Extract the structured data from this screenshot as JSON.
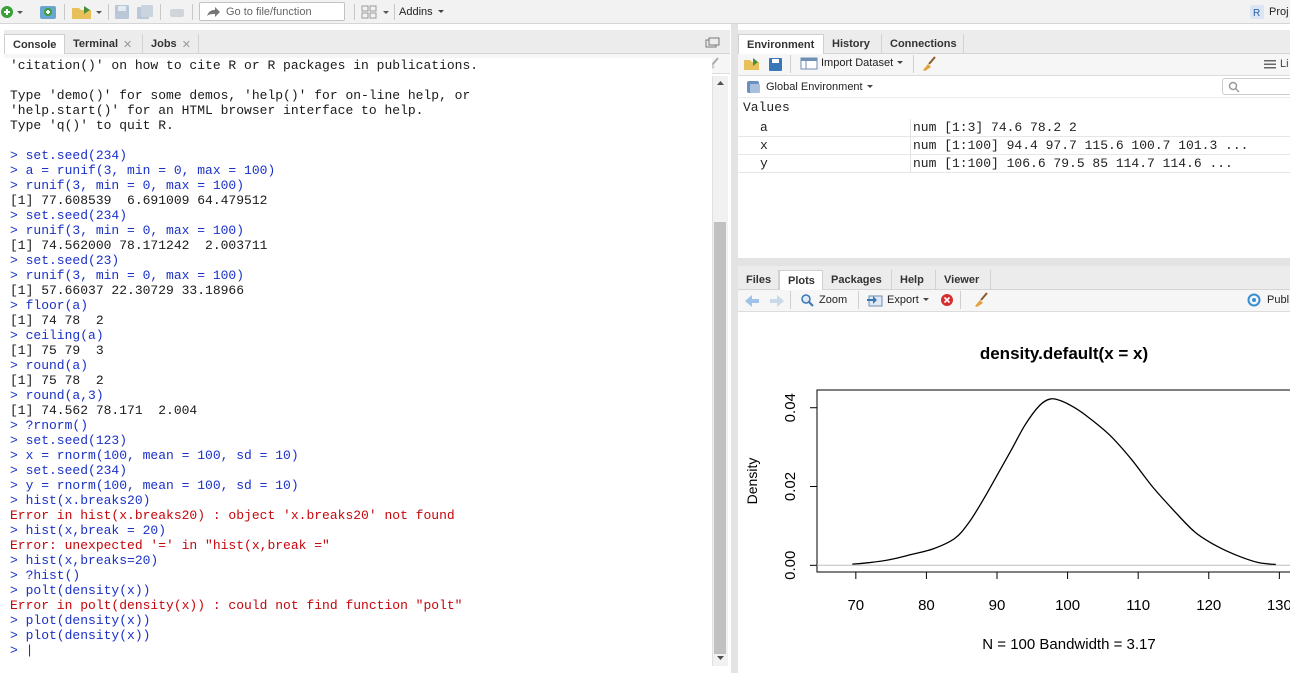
{
  "toolbar": {
    "goto_placeholder": "Go to file/function",
    "addins_label": "Addins",
    "project_label": "Proj"
  },
  "console_pane": {
    "tabs": [
      {
        "label": "Console",
        "active": true
      },
      {
        "label": "Terminal",
        "active": false
      },
      {
        "label": "Jobs",
        "active": false
      }
    ],
    "path": "~/",
    "lines": [
      {
        "kind": "out",
        "text": "'citation()' on how to cite R or R packages in publications."
      },
      {
        "kind": "blank",
        "text": ""
      },
      {
        "kind": "out",
        "text": "Type 'demo()' for some demos, 'help()' for on-line help, or"
      },
      {
        "kind": "out",
        "text": "'help.start()' for an HTML browser interface to help."
      },
      {
        "kind": "out",
        "text": "Type 'q()' to quit R."
      },
      {
        "kind": "blank",
        "text": ""
      },
      {
        "kind": "cmd",
        "text": "> set.seed(234)"
      },
      {
        "kind": "cmd",
        "text": "> a = runif(3, min = 0, max = 100)"
      },
      {
        "kind": "cmd",
        "text": "> runif(3, min = 0, max = 100)"
      },
      {
        "kind": "out",
        "text": "[1] 77.608539  6.691009 64.479512"
      },
      {
        "kind": "cmd",
        "text": "> set.seed(234)"
      },
      {
        "kind": "cmd",
        "text": "> runif(3, min = 0, max = 100)"
      },
      {
        "kind": "out",
        "text": "[1] 74.562000 78.171242  2.003711"
      },
      {
        "kind": "cmd",
        "text": "> set.seed(23)"
      },
      {
        "kind": "cmd",
        "text": "> runif(3, min = 0, max = 100)"
      },
      {
        "kind": "out",
        "text": "[1] 57.66037 22.30729 33.18966"
      },
      {
        "kind": "cmd",
        "text": "> floor(a)"
      },
      {
        "kind": "out",
        "text": "[1] 74 78  2"
      },
      {
        "kind": "cmd",
        "text": "> ceiling(a)"
      },
      {
        "kind": "out",
        "text": "[1] 75 79  3"
      },
      {
        "kind": "cmd",
        "text": "> round(a)"
      },
      {
        "kind": "out",
        "text": "[1] 75 78  2"
      },
      {
        "kind": "cmd",
        "text": "> round(a,3)"
      },
      {
        "kind": "out",
        "text": "[1] 74.562 78.171  2.004"
      },
      {
        "kind": "cmd",
        "text": "> ?rnorm()"
      },
      {
        "kind": "cmd",
        "text": "> set.seed(123)"
      },
      {
        "kind": "cmd",
        "text": "> x = rnorm(100, mean = 100, sd = 10)"
      },
      {
        "kind": "cmd",
        "text": "> set.seed(234)"
      },
      {
        "kind": "cmd",
        "text": "> y = rnorm(100, mean = 100, sd = 10)"
      },
      {
        "kind": "cmd",
        "text": "> hist(x.breaks20)"
      },
      {
        "kind": "err",
        "text": "Error in hist(x.breaks20) : object 'x.breaks20' not found"
      },
      {
        "kind": "cmd",
        "text": "> hist(x,break = 20)"
      },
      {
        "kind": "err",
        "text": "Error: unexpected '=' in \"hist(x,break =\""
      },
      {
        "kind": "cmd",
        "text": "> hist(x,breaks=20)"
      },
      {
        "kind": "cmd",
        "text": "> ?hist()"
      },
      {
        "kind": "cmd",
        "text": "> polt(density(x))"
      },
      {
        "kind": "err",
        "text": "Error in polt(density(x)) : could not find function \"polt\""
      },
      {
        "kind": "cmd",
        "text": "> plot(density(x))"
      },
      {
        "kind": "cmd",
        "text": "> plot(density(x))"
      },
      {
        "kind": "cmd",
        "text": "> |"
      }
    ]
  },
  "env_pane": {
    "tabs": [
      {
        "label": "Environment",
        "active": true
      },
      {
        "label": "History",
        "active": false
      },
      {
        "label": "Connections",
        "active": false
      }
    ],
    "import_label": "Import Dataset",
    "scope_label": "Global Environment",
    "list_label": "Li",
    "section_label": "Values",
    "rows": [
      {
        "name": "a",
        "value": "num [1:3] 74.6 78.2 2"
      },
      {
        "name": "x",
        "value": "num [1:100] 94.4 97.7 115.6 100.7 101.3 ..."
      },
      {
        "name": "y",
        "value": "num [1:100] 106.6 79.5 85 114.7 114.6 ..."
      }
    ]
  },
  "files_pane": {
    "tabs": [
      {
        "label": "Files",
        "active": false
      },
      {
        "label": "Plots",
        "active": true
      },
      {
        "label": "Packages",
        "active": false
      },
      {
        "label": "Help",
        "active": false
      },
      {
        "label": "Viewer",
        "active": false
      }
    ],
    "zoom_label": "Zoom",
    "export_label": "Export",
    "publish_label": "Publ"
  },
  "colors": {
    "command": "#1a31c8",
    "error": "#c5060b",
    "scrollbar_thumb": "#c1c1c1"
  },
  "chart_data": {
    "type": "line",
    "title": "density.default(x = x)",
    "xlabel": "N = 100   Bandwidth = 3.17",
    "ylabel": "Density",
    "x_ticks": [
      70,
      80,
      90,
      100,
      110,
      120,
      130
    ],
    "y_ticks": [
      "0.00",
      "0.02",
      "0.04"
    ],
    "xlim": [
      64.5,
      132.5
    ],
    "ylim": [
      -0.0017,
      0.0445
    ],
    "grid": false,
    "series": [
      {
        "x": [
          69.5,
          72,
          75,
          78,
          81,
          84,
          86,
          88,
          90,
          92,
          94,
          96,
          97.5,
          99,
          101,
          103,
          106,
          109,
          112,
          115,
          118,
          121,
          124,
          127,
          129.5
        ],
        "y": [
          0.0003,
          0.0007,
          0.0015,
          0.0028,
          0.0042,
          0.0068,
          0.0108,
          0.0165,
          0.0228,
          0.0292,
          0.0357,
          0.0405,
          0.0422,
          0.0418,
          0.04,
          0.0375,
          0.033,
          0.027,
          0.02,
          0.014,
          0.0085,
          0.005,
          0.0025,
          0.0007,
          0.0002
        ]
      }
    ]
  }
}
